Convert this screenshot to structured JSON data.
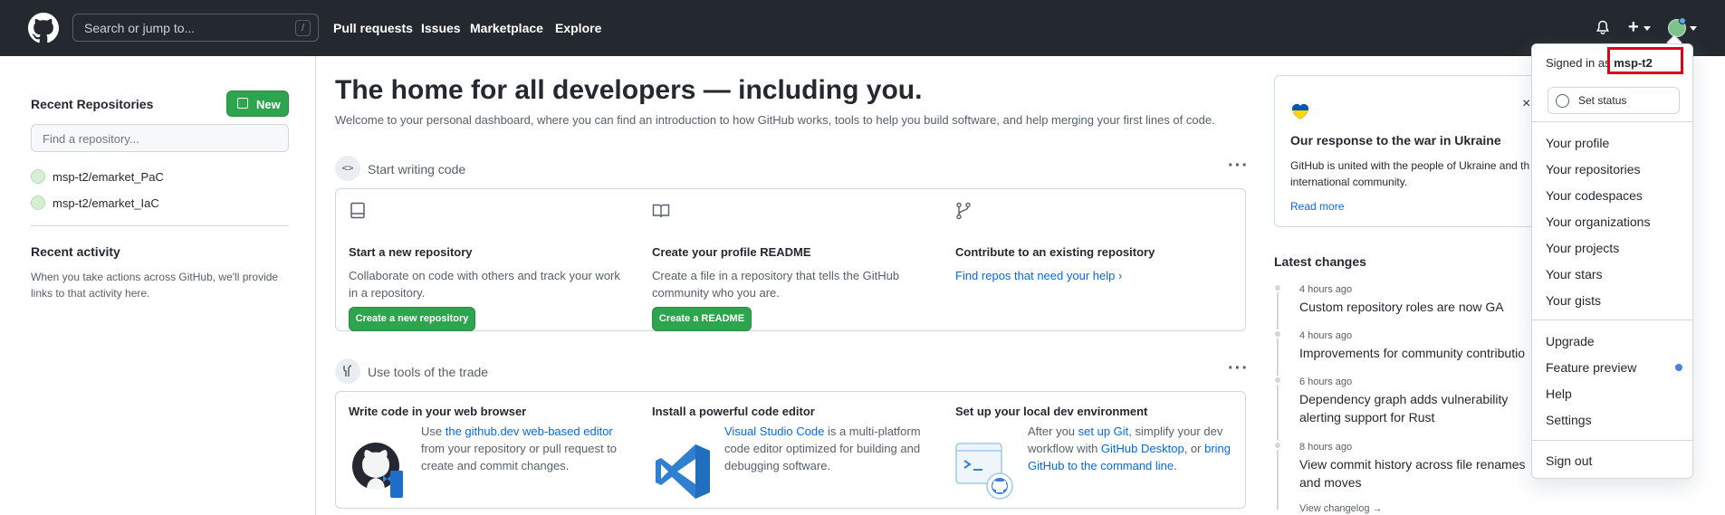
{
  "header": {
    "search_placeholder": "Search or jump to...",
    "search_shortcut": "/",
    "nav": [
      "Pull requests",
      "Issues",
      "Marketplace",
      "Explore"
    ],
    "plus": "+"
  },
  "sidebar": {
    "title": "Recent Repositories",
    "new_button": "New",
    "find_placeholder": "Find a repository...",
    "repos": [
      "msp-t2/emarket_PaC",
      "msp-t2/emarket_IaC"
    ],
    "activity_title": "Recent activity",
    "activity_text": "When you take actions across GitHub, we'll provide links to that activity here."
  },
  "main": {
    "title": "The home for all developers — including you.",
    "subtitle": "Welcome to your personal dashboard, where you can find an introduction to how GitHub works, tools to help you build software, and help merging your first lines of code.",
    "section1": {
      "label": "Start writing code",
      "icon": "<>",
      "more": "···",
      "cols": [
        {
          "title": "Start a new repository",
          "desc": "Collaborate on code with others and track your work in a repository.",
          "button": "Create a new repository"
        },
        {
          "title": "Create your profile README",
          "desc": "Create a file in a repository that tells the GitHub community who you are.",
          "button": "Create a README"
        },
        {
          "title": "Contribute to an existing repository",
          "link": "Find repos that need your help",
          "chevron": "›"
        }
      ]
    },
    "section2": {
      "label": "Use tools of the trade",
      "more": "···",
      "cols": [
        {
          "title": "Write code in your web browser",
          "pre": "Use ",
          "link": "the github.dev web-based editor",
          "post": " from your repository or pull request to create and commit changes."
        },
        {
          "title": "Install a powerful code editor",
          "link": "Visual Studio Code",
          "post": " is a multi-platform code editor optimized for building and debugging software."
        },
        {
          "title": "Set up your local dev environment",
          "pre": "After you ",
          "link1": "set up Git",
          "mid1": ", simplify your dev workflow with ",
          "link2": "GitHub Desktop",
          "mid2": ", or ",
          "link3": "bring GitHub to the command line",
          "post": "."
        }
      ]
    }
  },
  "right": {
    "ukraine_title": "Our response to the war in Ukraine",
    "ukraine_text": "GitHub is united with the people of Ukraine and th international community.",
    "ukraine_link": "Read more",
    "close": "×",
    "latest_title": "Latest changes",
    "changes": [
      {
        "time": "4 hours ago",
        "text": "Custom repository roles are now GA"
      },
      {
        "time": "4 hours ago",
        "text": "Improvements for community contributio"
      },
      {
        "time": "6 hours ago",
        "text": "Dependency graph adds vulnerability alerting support for Rust"
      },
      {
        "time": "8 hours ago",
        "text": "View commit history across file renames and moves"
      }
    ],
    "changelog": "View changelog →"
  },
  "dropdown": {
    "signed_prefix": "Signed in as",
    "username": "msp-t2",
    "set_status": "Set status",
    "items1": [
      "Your profile",
      "Your repositories",
      "Your codespaces",
      "Your organizations",
      "Your projects",
      "Your stars",
      "Your gists"
    ],
    "items2": [
      "Upgrade",
      "Feature preview",
      "Help",
      "Settings"
    ],
    "sign_out": "Sign out",
    "highlight_color": "#e1001a"
  }
}
